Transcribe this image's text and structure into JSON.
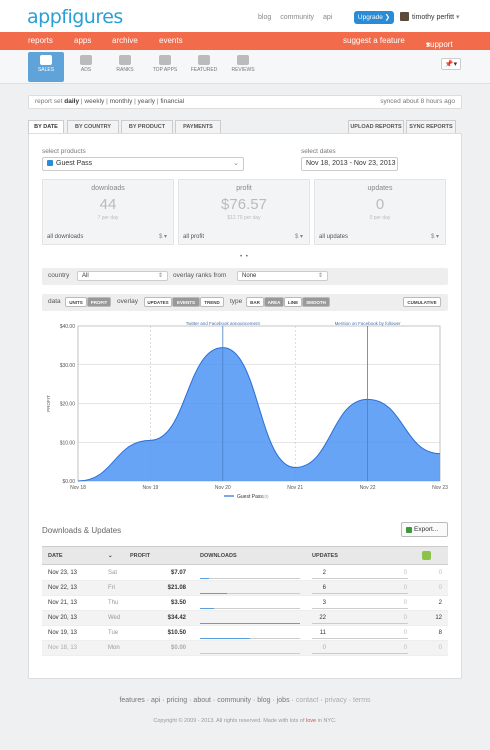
{
  "header": {
    "logo": "appfigures",
    "links": [
      "blog",
      "community",
      "api"
    ],
    "upgrade_label": "Upgrade",
    "upgrade_chevron": "❯",
    "user_name": "timothy perfitt",
    "user_chevron": "▾"
  },
  "nav": {
    "items": [
      "reports",
      "apps",
      "archive",
      "events"
    ],
    "suggest": "suggest a feature",
    "support": "support",
    "support_chevron": "▾"
  },
  "toolbar": {
    "items": [
      {
        "label": "SALES",
        "icon": "sales-icon"
      },
      {
        "label": "ADS",
        "icon": "ads-icon"
      },
      {
        "label": "RANKS",
        "icon": "ranks-icon"
      },
      {
        "label": "TOP APPS",
        "icon": "top-apps-icon"
      },
      {
        "label": "FEATURED",
        "icon": "featured-icon"
      },
      {
        "label": "REVIEWS",
        "icon": "reviews-icon"
      }
    ],
    "pin_label": "📌▾"
  },
  "reportset": {
    "label": "report set",
    "options": [
      "daily",
      "weekly",
      "monthly",
      "yearly",
      "financial"
    ],
    "selected": "daily",
    "synced": "synced about 8 hours ago"
  },
  "tabs": {
    "left": [
      "BY DATE",
      "BY COUNTRY",
      "BY PRODUCT",
      "PAYMENTS"
    ],
    "right": [
      "UPLOAD REPORTS",
      "SYNC REPORTS"
    ]
  },
  "filters": {
    "products_label": "select products",
    "product_value": "Guest Pass",
    "product_chevron": "⌄",
    "dates_label": "select dates",
    "dates_value": "Nov 18, 2013 - Nov 23, 2013"
  },
  "stats": [
    {
      "title": "downloads",
      "value": "44",
      "sub": "7 per day",
      "footer": "all downloads",
      "icon": "$ ▾"
    },
    {
      "title": "profit",
      "value": "$76.57",
      "sub": "$12.76 per day",
      "footer": "all profit",
      "icon": "$ ▾"
    },
    {
      "title": "updates",
      "value": "0",
      "sub": "0 per day",
      "footer": "all updates",
      "icon": "$ ▾"
    }
  ],
  "pager_dots": "• •",
  "country_row": {
    "country_label": "country",
    "country_value": "All",
    "overlay_label": "overlay ranks from",
    "overlay_value": "None",
    "chevron": "⇕"
  },
  "data_row": {
    "data_label": "data",
    "data_options": [
      "UNITS",
      "PROFIT"
    ],
    "data_selected": "PROFIT",
    "overlay_label": "overlay",
    "overlay_options": [
      "UPDATES",
      "EVENTS",
      "TREND"
    ],
    "overlay_selected": "EVENTS",
    "type_label": "type",
    "type_options": [
      "BAR",
      "AREA",
      "LINE",
      "SMOOTH"
    ],
    "type_selected": [
      "AREA",
      "SMOOTH"
    ],
    "cumulative": "CUMULATIVE"
  },
  "chart_data": {
    "type": "area",
    "x": [
      "Nov 18",
      "Nov 19",
      "Nov 20",
      "Nov 21",
      "Nov 22",
      "Nov 23"
    ],
    "series": [
      {
        "name": "Guest Pass",
        "values": [
          0.0,
          10.5,
          34.42,
          3.5,
          21.08,
          7.07
        ],
        "color": "#4d94f5"
      }
    ],
    "ylabel": "PROFIT",
    "yticks": [
      "$0.00",
      "$10.00",
      "$20.00",
      "$30.00",
      "$40.00"
    ],
    "ylim": [
      0,
      40
    ],
    "annotations": [
      {
        "x": "Nov 20",
        "label": "Twitter and Facebook announcement"
      },
      {
        "x": "Nov 22",
        "label": "Mention on Facebook by follower"
      }
    ],
    "legend": "Guest Pass",
    "legend_extra": "(0)",
    "legend_position": "bottom",
    "grid": true
  },
  "table": {
    "title": "Downloads & Updates",
    "export_label": "Export...",
    "columns": [
      "DATE",
      "PROFIT",
      "DOWNLOADS",
      "UPDATES"
    ],
    "date_sort_icon": "⌄",
    "rows": [
      {
        "date": "Nov 23, 13",
        "day": "Sat",
        "profit": "$7.07",
        "downloads": "2",
        "dl_frac": 0.09,
        "upd": "0",
        "extra": "0",
        "muted": false
      },
      {
        "date": "Nov 22, 13",
        "day": "Fri",
        "profit": "$21.08",
        "downloads": "6",
        "dl_frac": 0.27,
        "upd": "0",
        "extra": "0",
        "muted": false
      },
      {
        "date": "Nov 21, 13",
        "day": "Thu",
        "profit": "$3.50",
        "downloads": "3",
        "dl_frac": 0.14,
        "upd": "0",
        "extra": "2",
        "muted": false
      },
      {
        "date": "Nov 20, 13",
        "day": "Wed",
        "profit": "$34.42",
        "downloads": "22",
        "dl_frac": 1.0,
        "upd": "0",
        "extra": "12",
        "muted": false
      },
      {
        "date": "Nov 19, 13",
        "day": "Tue",
        "profit": "$10.50",
        "downloads": "11",
        "dl_frac": 0.5,
        "upd": "0",
        "extra": "8",
        "muted": false
      },
      {
        "date": "Nov 18, 13",
        "day": "Mon",
        "profit": "$0.00",
        "downloads": "0",
        "dl_frac": 0.0,
        "upd": "0",
        "extra": "0",
        "muted": true
      }
    ]
  },
  "footer": {
    "links": [
      "features",
      "api",
      "pricing",
      "about",
      "community",
      "blog",
      "jobs",
      "contact",
      "privacy",
      "terms"
    ],
    "separator": " · ",
    "copyright_pre": "Copyright © 2009 - 2013. All rights reserved. Made with lots of ",
    "love": "love",
    "copyright_post": " in NYC."
  }
}
